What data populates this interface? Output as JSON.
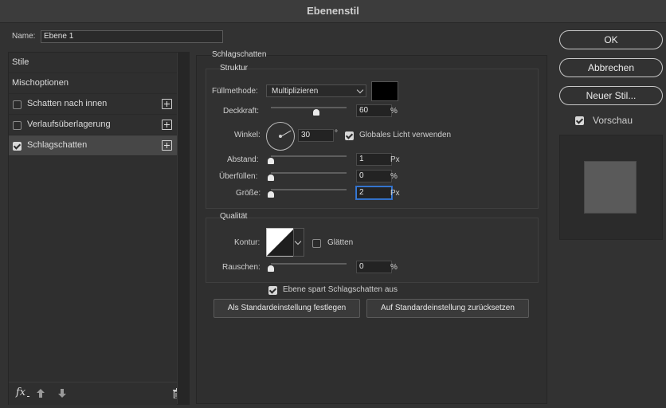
{
  "window": {
    "title": "Ebenenstil"
  },
  "name_field": {
    "label": "Name:",
    "value": "Ebene 1"
  },
  "style_list": {
    "items": [
      {
        "label": "Stile"
      },
      {
        "label": "Mischoptionen"
      },
      {
        "label": "Schatten nach innen",
        "checked": false
      },
      {
        "label": "Verlaufsüberlagerung",
        "checked": false
      },
      {
        "label": "Schlagschatten",
        "checked": true,
        "selected": true
      }
    ],
    "footer": {
      "fx_label": "fx",
      "icons": [
        "fx-icon",
        "move-up-icon",
        "move-down-icon",
        "trash-icon"
      ]
    }
  },
  "section": {
    "title": "Schlagschatten",
    "structure": {
      "title": "Struktur",
      "blend_mode": {
        "label": "Füllmethode:",
        "value": "Multiplizieren"
      },
      "color_swatch": "#000000",
      "opacity": {
        "label": "Deckkraft:",
        "value": "60",
        "unit": "%",
        "level": 0.6
      },
      "angle": {
        "label": "Winkel:",
        "value": "30",
        "unit": "°",
        "degrees": 30
      },
      "global_light": {
        "label": "Globales Licht verwenden",
        "checked": true
      },
      "distance": {
        "label": "Abstand:",
        "value": "1",
        "unit": "Px",
        "level": 0.0
      },
      "spread": {
        "label": "Überfüllen:",
        "value": "0",
        "unit": "%",
        "level": 0.0
      },
      "size": {
        "label": "Größe:",
        "value": "2",
        "unit": "Px",
        "level": 0.0
      }
    },
    "quality": {
      "title": "Qualität",
      "contour_label": "Kontur:",
      "antialias": {
        "label": "Glätten",
        "checked": false
      },
      "noise": {
        "label": "Rauschen:",
        "value": "0",
        "unit": "%",
        "level": 0.0
      }
    },
    "knockout": {
      "label": "Ebene spart Schlagschatten aus",
      "checked": true
    },
    "buttons": {
      "set_default": "Als Standardeinstellung festlegen",
      "reset_default": "Auf Standardeinstellung zurücksetzen"
    }
  },
  "right": {
    "ok": "OK",
    "cancel": "Abbrechen",
    "new_style": "Neuer Stil...",
    "preview": {
      "label": "Vorschau",
      "checked": true
    }
  },
  "colors": {
    "accent_focus": "#3a7bd5",
    "panel": "#323232"
  }
}
